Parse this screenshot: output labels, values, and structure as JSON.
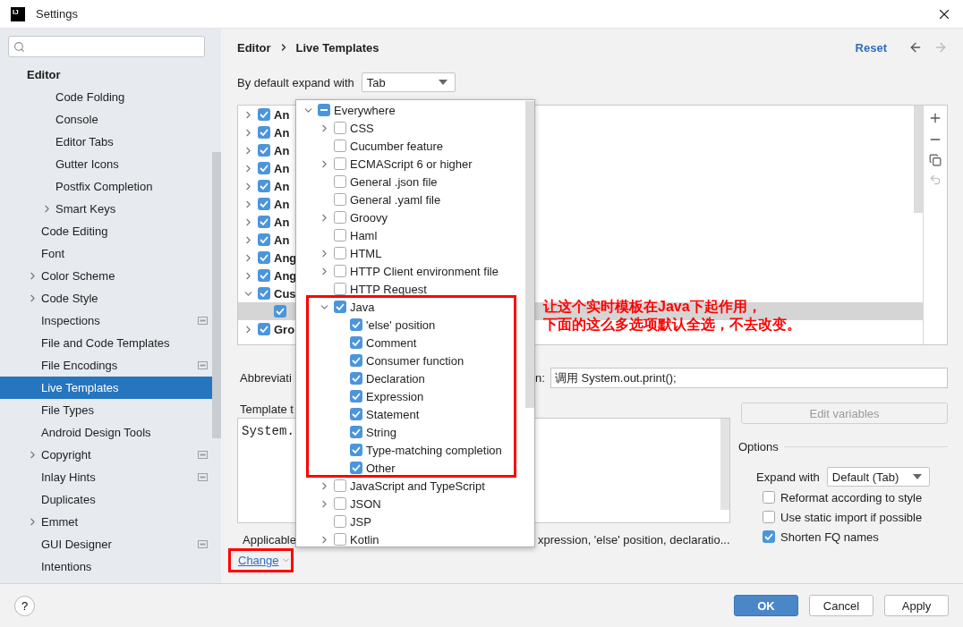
{
  "window": {
    "title": "Settings",
    "app_icon_text": "IJ"
  },
  "sidebar": {
    "items": [
      {
        "label": "Editor",
        "selected": false,
        "project_level": false,
        "children": [
          {
            "children": [
              {
                "label": "Code Folding",
                "selected": false,
                "project_level": false
              },
              {
                "label": "Console",
                "selected": false,
                "project_level": false
              },
              {
                "label": "Editor Tabs",
                "selected": false,
                "project_level": false
              },
              {
                "label": "Gutter Icons",
                "selected": false,
                "project_level": false
              },
              {
                "label": "Postfix Completion",
                "selected": false,
                "project_level": false
              },
              {
                "label": "Smart Keys",
                "selected": false,
                "project_level": false,
                "expanded": false
              }
            ]
          },
          {
            "label": "Code Editing",
            "selected": false,
            "project_level": false
          },
          {
            "label": "Font",
            "selected": false,
            "project_level": false
          },
          {
            "label": "Color Scheme",
            "selected": false,
            "project_level": false,
            "expanded": false
          },
          {
            "label": "Code Style",
            "selected": false,
            "project_level": false,
            "expanded": false
          },
          {
            "label": "Inspections",
            "selected": false,
            "project_level": true
          },
          {
            "label": "File and Code Templates",
            "selected": false,
            "project_level": false
          },
          {
            "label": "File Encodings",
            "selected": false,
            "project_level": true
          },
          {
            "label": "Live Templates",
            "selected": true,
            "project_level": false
          },
          {
            "label": "File Types",
            "selected": false,
            "project_level": false
          },
          {
            "label": "Android Design Tools",
            "selected": false,
            "project_level": false
          },
          {
            "label": "Copyright",
            "selected": false,
            "project_level": true,
            "expanded": false
          },
          {
            "label": "Inlay Hints",
            "selected": false,
            "project_level": true
          },
          {
            "label": "Duplicates",
            "selected": false,
            "project_level": false
          },
          {
            "label": "Emmet",
            "selected": false,
            "project_level": false,
            "expanded": false
          },
          {
            "label": "GUI Designer",
            "selected": false,
            "project_level": true
          },
          {
            "label": "Intentions",
            "selected": false,
            "project_level": false
          }
        ]
      }
    ]
  },
  "header": {
    "breadcrumb": [
      "Editor",
      "Live Templates"
    ],
    "reset": "Reset",
    "back_enabled": true,
    "forward_enabled": false
  },
  "expand_default": {
    "label": "By default expand with",
    "value": "Tab"
  },
  "templates": [
    {
      "label": "An",
      "checked": true,
      "expanded": false,
      "selected": false
    },
    {
      "label": "An",
      "checked": true,
      "expanded": false,
      "selected": false
    },
    {
      "label": "An",
      "checked": true,
      "expanded": false,
      "selected": false
    },
    {
      "label": "An",
      "checked": true,
      "expanded": false,
      "selected": false
    },
    {
      "label": "An",
      "checked": true,
      "expanded": false,
      "selected": false
    },
    {
      "label": "An",
      "checked": true,
      "expanded": false,
      "selected": false
    },
    {
      "label": "An",
      "checked": true,
      "expanded": false,
      "selected": false
    },
    {
      "label": "An",
      "checked": true,
      "expanded": false,
      "selected": false
    },
    {
      "label": "Ang",
      "checked": true,
      "expanded": false,
      "selected": false
    },
    {
      "label": "Ang",
      "checked": true,
      "expanded": false,
      "selected": false
    },
    {
      "label": "Cus",
      "checked": true,
      "expanded": true,
      "selected": false,
      "children": [
        {
          "checked": true,
          "selected": true
        }
      ]
    },
    {
      "label": "Gro",
      "checked": true,
      "expanded": false,
      "selected": false
    }
  ],
  "editor": {
    "abbreviation_label": "Abbreviati",
    "description_label": "n:",
    "description": "调用 System.out.print();",
    "template_text_label": "Template t",
    "template_text": "System.",
    "edit_variables": {
      "label": "Edit variables",
      "disabled": true
    },
    "applicable_label": "Applicable",
    "applicable_text": "xpression, 'else' position, declaratio...",
    "change": "Change"
  },
  "options": {
    "title": "Options",
    "expand_with_label": "Expand with",
    "expand_with": "Default (Tab)",
    "checkboxes": [
      {
        "label": "Reformat according to style",
        "checked": false
      },
      {
        "label": "Use static import if possible",
        "checked": false
      },
      {
        "label": "Shorten FQ names",
        "checked": true
      }
    ]
  },
  "context_popup": {
    "root": {
      "label": "Everywhere",
      "mixed": true,
      "expanded": true,
      "children": [
        {
          "label": "CSS",
          "checked": false,
          "expanded": false
        },
        {
          "label": "Cucumber feature",
          "checked": false
        },
        {
          "label": "ECMAScript 6 or higher",
          "checked": false,
          "expanded": false
        },
        {
          "label": "General .json file",
          "checked": false
        },
        {
          "label": "General .yaml file",
          "checked": false
        },
        {
          "label": "Groovy",
          "checked": false,
          "expanded": false
        },
        {
          "label": "Haml",
          "checked": false
        },
        {
          "label": "HTML",
          "checked": false,
          "expanded": false
        },
        {
          "label": "HTTP Client environment file",
          "checked": false,
          "expanded": false
        },
        {
          "label": "HTTP Request",
          "checked": false
        },
        {
          "label": "Java",
          "checked": true,
          "expanded": true,
          "children": [
            {
              "label": "'else' position",
              "checked": true
            },
            {
              "label": "Comment",
              "checked": true
            },
            {
              "label": "Consumer function",
              "checked": true
            },
            {
              "label": "Declaration",
              "checked": true
            },
            {
              "label": "Expression",
              "checked": true
            },
            {
              "label": "Statement",
              "checked": true
            },
            {
              "label": "String",
              "checked": true
            },
            {
              "label": "Type-matching completion",
              "checked": true
            },
            {
              "label": "Other",
              "checked": true
            }
          ]
        },
        {
          "label": "JavaScript and TypeScript",
          "checked": false,
          "expanded": false
        },
        {
          "label": "JSON",
          "checked": false,
          "expanded": false
        },
        {
          "label": "JSP",
          "checked": false
        },
        {
          "label": "Kotlin",
          "checked": false,
          "expanded": false
        }
      ]
    }
  },
  "annotation": {
    "lines": [
      "让这个实时模板在Java下起作用，",
      "下面的这么多选项默认全选，不去改变。"
    ]
  },
  "footer": {
    "help": "?",
    "buttons": [
      {
        "label": "OK",
        "primary": true
      },
      {
        "label": "Cancel",
        "primary": false
      },
      {
        "label": "Apply",
        "primary": false
      }
    ]
  }
}
